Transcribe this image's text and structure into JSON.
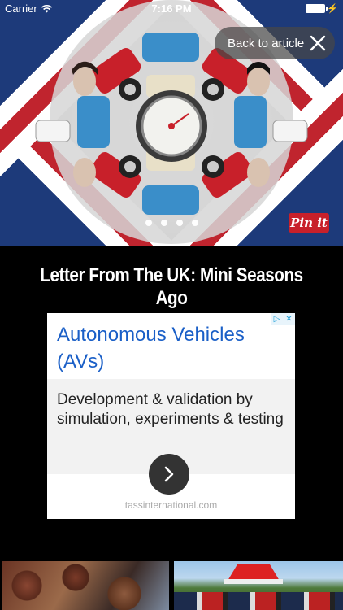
{
  "status_bar": {
    "carrier": "Carrier",
    "time": "7:16 PM"
  },
  "gallery": {
    "back_label": "Back to article",
    "pages": 4,
    "pin_label": "Pin it"
  },
  "article": {
    "title": "Letter From The UK: Mini Seasons Ago"
  },
  "ad": {
    "headline": "Autonomous Vehicles (AVs)",
    "body": "Development & validation by simulation, experiments & testing",
    "url": "tassinternational.com"
  },
  "colors": {
    "pin_red": "#c8202a",
    "ad_blue": "#1a5fc7",
    "background": "#000000"
  }
}
